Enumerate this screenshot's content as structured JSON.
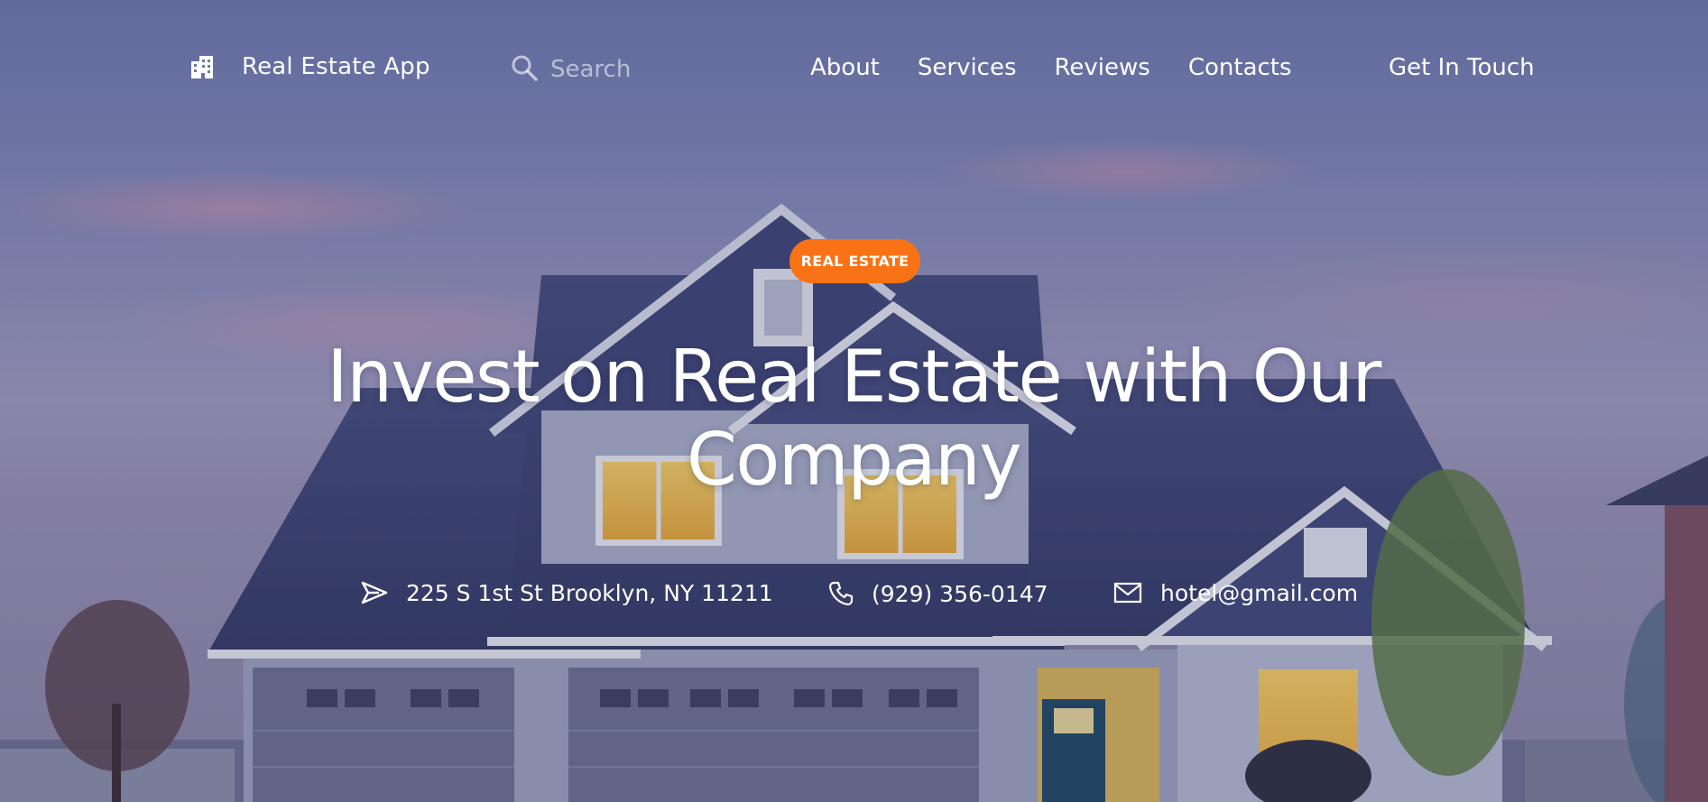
{
  "nav": {
    "logo_icon": "building-icon",
    "brand": "Real Estate App",
    "search": {
      "icon": "search-icon",
      "placeholder": "Search",
      "value": ""
    },
    "links": [
      "About",
      "Services",
      "Reviews",
      "Contacts"
    ],
    "cta": "Get In Touch"
  },
  "hero": {
    "badge": "REAL ESTATE",
    "headline": "Invest on Real Estate with Our Company",
    "contacts": {
      "address": {
        "icon": "send-icon",
        "text": "225 S 1st St Brooklyn, NY 11211"
      },
      "phone": {
        "icon": "phone-icon",
        "text": "(929) 356-0147"
      },
      "email": {
        "icon": "mail-icon",
        "text": "hotel@gmail.com"
      }
    }
  },
  "colors": {
    "accent": "#f97316",
    "text": "#ffffff",
    "sky_top": "#6d78ad",
    "roof": "#3c4270",
    "window_glow": "#f4c04a"
  }
}
